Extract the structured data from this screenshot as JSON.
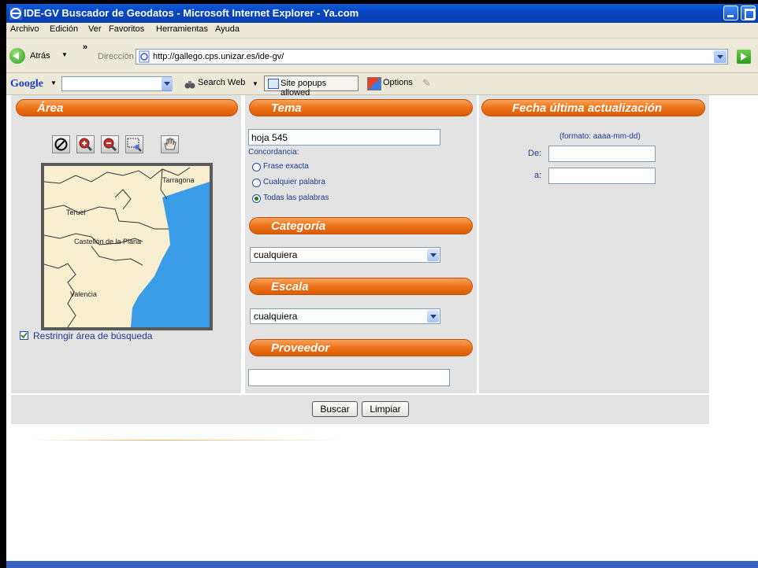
{
  "window": {
    "title": "IDE-GV Buscador de Geodatos - Microsoft Internet Explorer - Ya.com"
  },
  "menu": [
    "Archivo",
    "Edición",
    "Ver",
    "Favoritos",
    "Herramientas",
    "Ayuda"
  ],
  "nav": {
    "back_label": "Atrás",
    "more": "»",
    "address_label": "Dirección",
    "url": "http://gallego.cps.unizar.es/ide-gv/"
  },
  "google_toolbar": {
    "logo": "Google",
    "search_web": "Search Web",
    "popups": "Site popups allowed",
    "options": "Options"
  },
  "area": {
    "title": "Área",
    "map_labels": [
      "Tarragona",
      "Teruel",
      "Castellón de la Plana",
      "Valencia"
    ],
    "restrict_label": "Restringir área de búsqueda",
    "restrict_checked": true
  },
  "tema": {
    "title": "Tema",
    "value": "hoja 545",
    "concordancia_label": "Concordancia:",
    "options": [
      "Frase exacta",
      "Cualquier palabra",
      "Todas las palabras"
    ],
    "selected": "Todas las palabras"
  },
  "categoria": {
    "title": "Categoría",
    "value": "cualquiera"
  },
  "escala": {
    "title": "Escala",
    "value": "cualquiera"
  },
  "proveedor": {
    "title": "Proveedor",
    "value": ""
  },
  "fecha": {
    "title": "Fecha última actualización",
    "format": "(formato: aaaa-mm-dd)",
    "de_label": "De:",
    "a_label": "a:"
  },
  "actions": {
    "search": "Buscar",
    "clear": "Limpiar"
  }
}
